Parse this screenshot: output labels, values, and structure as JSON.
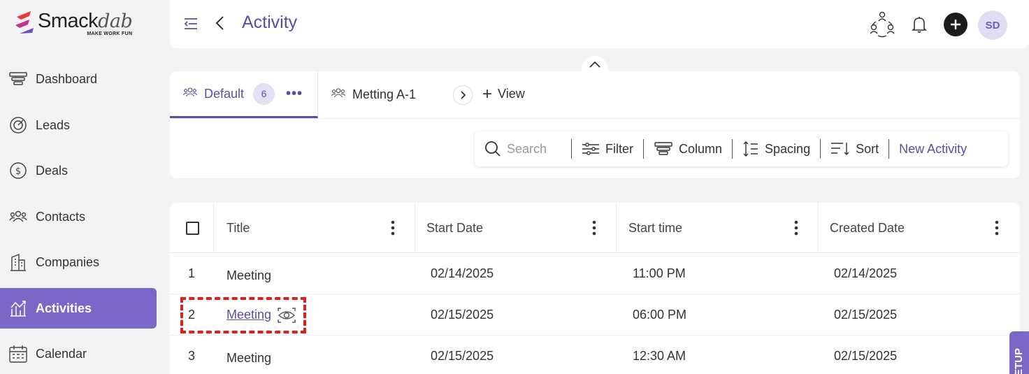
{
  "brand": {
    "name_main": "Smack",
    "name_accent": "dab",
    "tagline": "MAKE WORK FUN",
    "color": "#e83a3a"
  },
  "sidebar": {
    "items": [
      {
        "label": "Dashboard",
        "icon": "dashboard-icon"
      },
      {
        "label": "Leads",
        "icon": "target-icon"
      },
      {
        "label": "Deals",
        "icon": "dollar-icon"
      },
      {
        "label": "Contacts",
        "icon": "contacts-icon"
      },
      {
        "label": "Companies",
        "icon": "building-icon"
      },
      {
        "label": "Activities",
        "icon": "activity-icon",
        "active": true
      },
      {
        "label": "Calendar",
        "icon": "calendar-icon"
      }
    ]
  },
  "header": {
    "title": "Activity",
    "avatar_initials": "SD"
  },
  "views": {
    "tabs": [
      {
        "label": "Default",
        "count": "6",
        "active": true
      },
      {
        "label": "Metting A-1"
      }
    ],
    "add_view_label": "View"
  },
  "toolbar": {
    "search_placeholder": "Search",
    "filter_label": "Filter",
    "column_label": "Column",
    "spacing_label": "Spacing",
    "sort_label": "Sort",
    "new_activity_label": "New Activity"
  },
  "table": {
    "columns": [
      "Title",
      "Start Date",
      "Start time",
      "Created Date"
    ],
    "rows": [
      {
        "num": "1",
        "title": "Meeting",
        "start_date": "02/14/2025",
        "start_time": "11:00 PM",
        "created_date": "02/14/2025"
      },
      {
        "num": "2",
        "title": "Meeting",
        "start_date": "02/15/2025",
        "start_time": "06:00 PM",
        "created_date": "02/15/2025"
      },
      {
        "num": "3",
        "title": "Meeting",
        "start_date": "02/15/2025",
        "start_time": "12:30 AM",
        "created_date": "02/15/2025"
      }
    ]
  },
  "setup_label": "SETUP",
  "colors": {
    "accent": "#5b4fa5",
    "active_nav": "#7b68c6",
    "highlight": "#e41c1c"
  }
}
